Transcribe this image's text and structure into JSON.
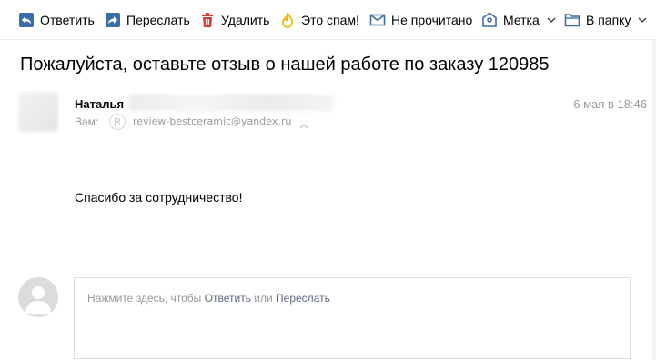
{
  "toolbar": {
    "reply": "Ответить",
    "forward": "Переслать",
    "delete": "Удалить",
    "spam": "Это спам!",
    "unread": "Не прочитано",
    "label": "Метка",
    "folder": "В папку"
  },
  "icons": {
    "reply": "reply-icon",
    "forward": "forward-icon",
    "delete": "trash-icon",
    "spam": "flame-icon",
    "unread": "envelope-icon",
    "label": "tag-icon",
    "folder": "folder-icon"
  },
  "colors": {
    "toolbar_icon": "#3b6ea8",
    "delete_icon": "#e0382e",
    "spam_icon": "#f5b800",
    "meta_text": "#999999",
    "link": "#5e6a80"
  },
  "message": {
    "subject": "Пожалуйста, оставьте отзыв о нашей работе по заказу 120985",
    "sender_name": "Наталья",
    "date": "6 мая в 18:46",
    "to_label": "Вам:",
    "to_avatar_letter": "R",
    "to_email": "review-bestceramic@yandex.ru",
    "body": "Спасибо за сотрудничество!"
  },
  "reply": {
    "hint_prefix": "Нажмите здесь, чтобы ",
    "reply_link": "Ответить",
    "or": " или ",
    "forward_link": "Переслать"
  }
}
